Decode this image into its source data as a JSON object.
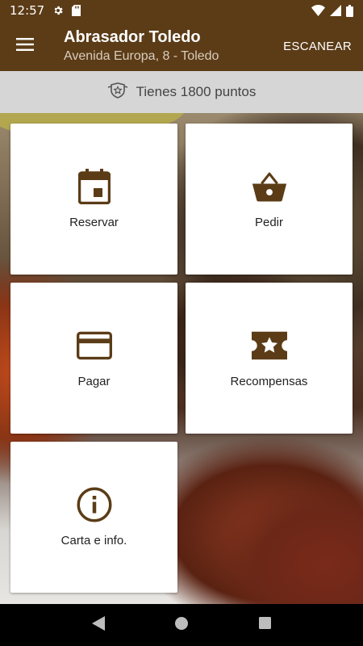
{
  "status": {
    "time": "12:57",
    "icons": [
      "settings-icon",
      "sd-card-icon",
      "wifi-icon",
      "signal-icon",
      "battery-icon"
    ]
  },
  "header": {
    "title": "Abrasador Toledo",
    "subtitle": "Avenida Europa, 8 - Toledo",
    "scan_label": "ESCANEAR"
  },
  "points": {
    "text": "Tienes 1800 puntos",
    "icon": "badge-icon"
  },
  "tiles": [
    {
      "label": "Reservar",
      "icon": "calendar-icon"
    },
    {
      "label": "Pedir",
      "icon": "basket-icon"
    },
    {
      "label": "Pagar",
      "icon": "credit-card-icon"
    },
    {
      "label": "Recompensas",
      "icon": "ticket-star-icon"
    },
    {
      "label": "Carta e info.",
      "icon": "info-icon"
    }
  ],
  "nav": [
    "back-icon",
    "home-icon",
    "recents-icon"
  ],
  "colors": {
    "brand": "#5b3c17",
    "points_bg": "#d6d6d6",
    "tile_bg": "#ffffff"
  }
}
